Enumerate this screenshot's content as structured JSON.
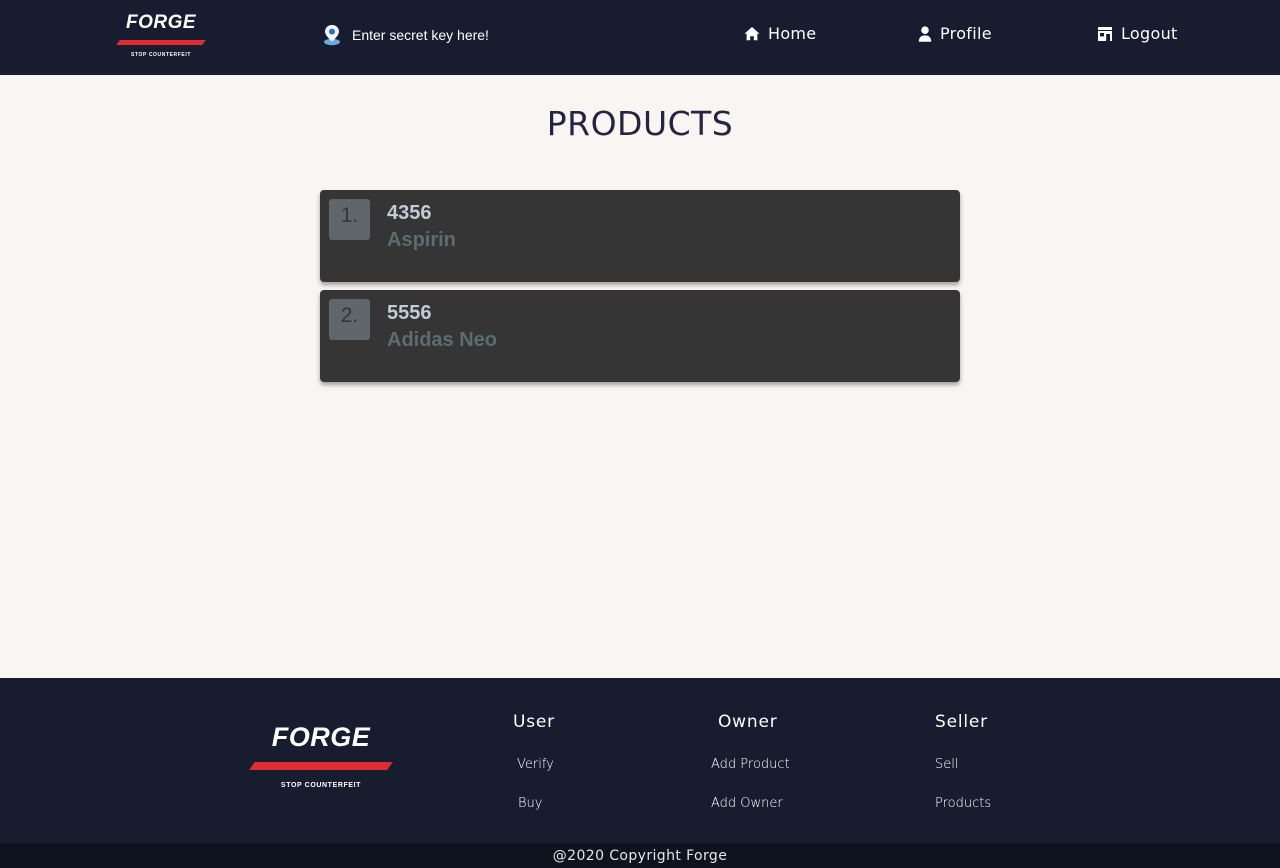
{
  "brand": {
    "name": "FORGE",
    "tagline": "STOP COUNTERFEIT",
    "accent": "#e02c33"
  },
  "header": {
    "secret_key_text": "Enter secret key here!",
    "nav": [
      {
        "label": "Home",
        "icon": "home-icon"
      },
      {
        "label": "Profile",
        "icon": "user-icon"
      },
      {
        "label": "Logout",
        "icon": "store-icon"
      }
    ]
  },
  "main": {
    "title": "PRODUCTS",
    "products": [
      {
        "index": "1.",
        "id": "4356",
        "name": "Aspirin"
      },
      {
        "index": "2.",
        "id": "5556",
        "name": "Adidas Neo"
      }
    ]
  },
  "footer": {
    "columns": [
      {
        "title": "User",
        "links": [
          "Verify",
          "Buy"
        ]
      },
      {
        "title": "Owner",
        "links": [
          "Add Product",
          "Add Owner"
        ]
      },
      {
        "title": "Seller",
        "links": [
          "Sell",
          "Products"
        ]
      }
    ],
    "copyright": "@2020 Copyright Forge"
  },
  "colors": {
    "header_bg": "#171d2f",
    "page_bg": "#f8f5f2",
    "card_bg": "#353535"
  }
}
